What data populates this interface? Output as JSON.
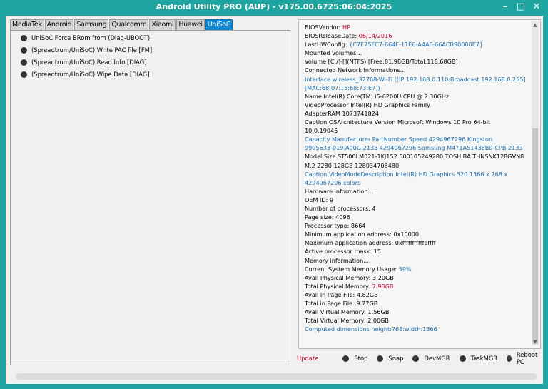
{
  "window": {
    "title": "Android Utility PRO (AUP) - v175.00.6725:06:04:2025",
    "controls": [
      "–",
      "□",
      "✕"
    ]
  },
  "tabs": [
    {
      "label": "MediaTek"
    },
    {
      "label": "Android"
    },
    {
      "label": "Samsung"
    },
    {
      "label": "Qualcomm"
    },
    {
      "label": "Xiaomi"
    },
    {
      "label": "Huawei"
    },
    {
      "label": "UniSoC",
      "active": true
    }
  ],
  "operations": [
    {
      "label": "UniSoC Force BRom from (Diag-UBOOT)"
    },
    {
      "label": "(Spreadtrum/UniSoC) Write PAC file [FM]"
    },
    {
      "label": "(Spreadtrum/UniSoC) Read Info [DIAG]"
    },
    {
      "label": "(Spreadtrum/UniSoC) Wipe Data [DIAG]"
    }
  ],
  "log": [
    {
      "k": "BIOSVendor: ",
      "v": "HP",
      "vc": "red"
    },
    {
      "k": "BIOSReleaseDate: ",
      "v": "06/14/2016",
      "vc": "red"
    },
    {
      "k": "LastHWConfig: ",
      "v": "{C7E75FC7-664F-11E6-A4AF-66ACB90000E7}",
      "vc": "blue"
    },
    {
      "k": "Mounted Volumes...",
      "v": ""
    },
    {
      "k": "Volume [C:/]-[](NTFS) [Free:81.98GB/Total:118.68GB]",
      "v": ""
    },
    {
      "k": "Connected Network Informations...",
      "v": ""
    },
    {
      "k": "Interface wireless_32768-Wi-Fi ([IP:192.168.0.110:Broadcast:192.168.0.255]",
      "v": "",
      "c": "blue"
    },
    {
      "k": "[MAC:68:07:15:68:73:E7])",
      "v": "",
      "c": "blue"
    },
    {
      "k": "Name Intel(R) Core(TM) i5-6200U CPU @ 2.30GHz",
      "v": ""
    },
    {
      "k": "VideoProcessor Intel(R) HD Graphics Family",
      "v": ""
    },
    {
      "k": "AdapterRAM 1073741824",
      "v": ""
    },
    {
      "k": "Caption OSArchitecture Version Microsoft Windows 10 Pro 64-bit",
      "v": ""
    },
    {
      "k": "10.0.19045",
      "v": ""
    },
    {
      "k": "Capacity Manufacturer PartNumber Speed 4294967296 Kingston",
      "v": "",
      "c": "blue"
    },
    {
      "k": "9905633-019.A00G 2133 4294967296 Samsung M471A5143EB0-CPB 2133",
      "v": "",
      "c": "blue"
    },
    {
      "k": "Model Size ST500LM021-1KJ152 500105249280 TOSHIBA THNSNK128GVN8",
      "v": ""
    },
    {
      "k": "M.2 2280 128GB 128034708480",
      "v": ""
    },
    {
      "k": "Caption VideoModeDescription Intel(R) HD Graphics 520 1366 x 768 x",
      "v": "",
      "c": "blue"
    },
    {
      "k": "4294967296 colors",
      "v": "",
      "c": "blue"
    },
    {
      "k": "Hardware information...",
      "v": ""
    },
    {
      "k": "OEM ID: 9",
      "v": ""
    },
    {
      "k": "Number of processors: 4",
      "v": ""
    },
    {
      "k": "Page size: 4096",
      "v": ""
    },
    {
      "k": "Processor type: 8664",
      "v": ""
    },
    {
      "k": "Minimum application address: 0x10000",
      "v": ""
    },
    {
      "k": "Maximum application address: 0xfffffffffffeffff",
      "v": ""
    },
    {
      "k": "Active processor mask: 15",
      "v": ""
    },
    {
      "k": "Memory information...",
      "v": ""
    },
    {
      "k": "Current System Memory Usage: ",
      "v": "59%",
      "vc": "blue"
    },
    {
      "k": "Avail Physical Memory: 3.20GB",
      "v": ""
    },
    {
      "k": "Total Physical Memory: ",
      "v": "7.90GB",
      "vc": "red"
    },
    {
      "k": "Avail in Page File: 4.82GB",
      "v": ""
    },
    {
      "k": "Total in Page File: 9.77GB",
      "v": ""
    },
    {
      "k": "Avail Virtual Memory: 1.56GB",
      "v": ""
    },
    {
      "k": "Total Virtual Memory: 2.00GB",
      "v": ""
    },
    {
      "k": "Computed dimensions height:768:width:1366",
      "v": "",
      "c": "blue"
    }
  ],
  "actions": {
    "update": "Update",
    "buttons": [
      {
        "label": "Stop"
      },
      {
        "label": "Snap"
      },
      {
        "label": "DevMGR"
      },
      {
        "label": "TaskMGR"
      },
      {
        "label": "Reboot PC"
      }
    ]
  },
  "colors": {
    "accent": "#1ea5a1",
    "tab_active": "#0c8ad6",
    "red": "#c2002a",
    "blue": "#1d6fb0"
  }
}
